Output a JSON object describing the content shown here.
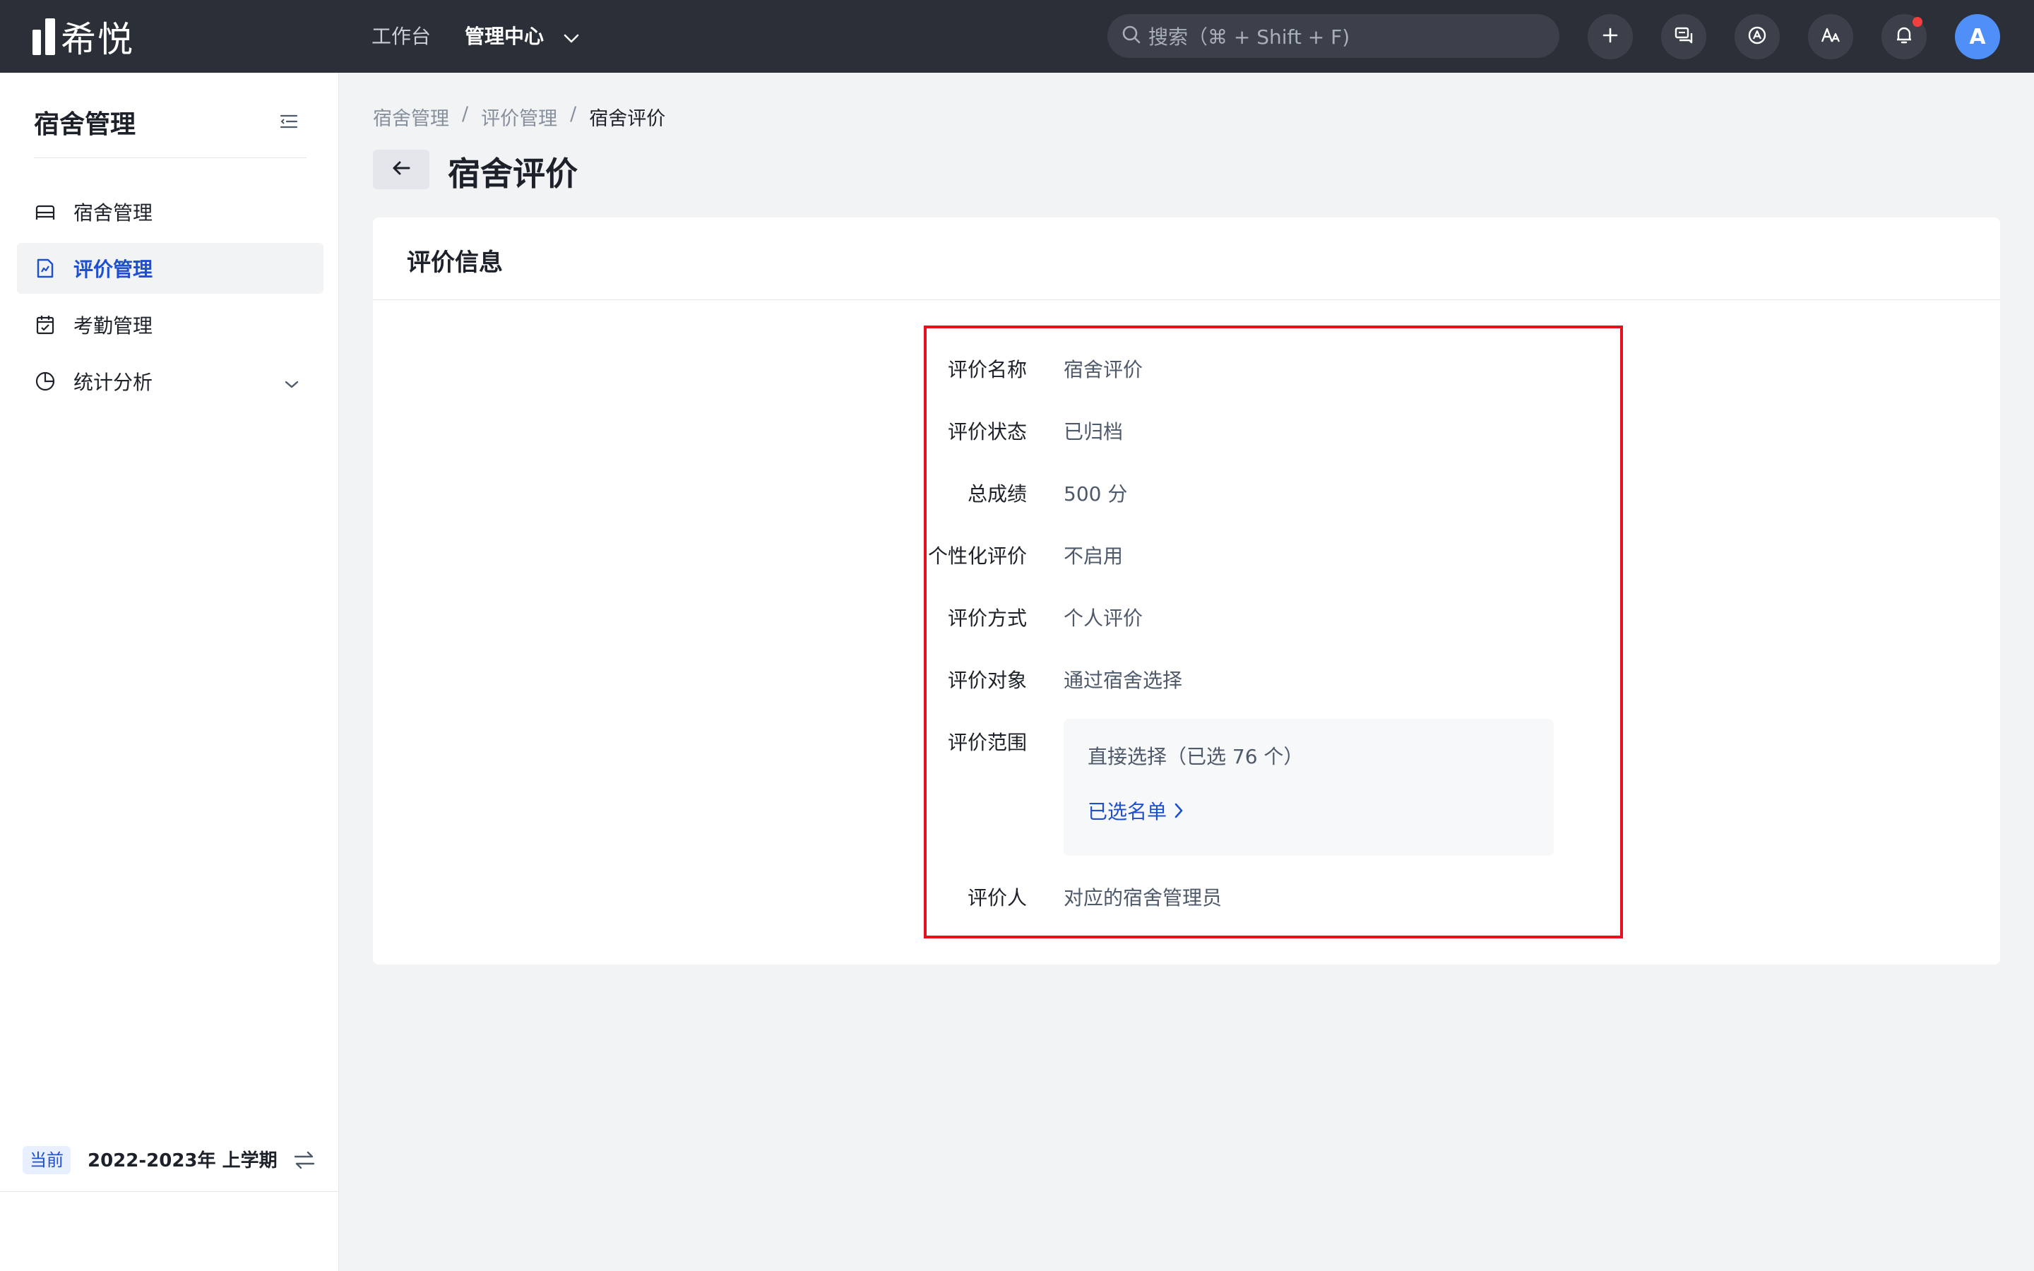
{
  "app": {
    "logo_text": "希悦"
  },
  "topnav": {
    "workbench": "工作台",
    "admin_center": "管理中心",
    "search_placeholder": "搜索（⌘ + Shift + F)",
    "avatar_letter": "A",
    "icons": [
      "plus-icon",
      "message-icon",
      "app-store-icon",
      "translate-icon",
      "bell-icon"
    ],
    "notification_dot_color": "#f53f3f"
  },
  "sidebar": {
    "title": "宿舍管理",
    "items": [
      {
        "label": "宿舍管理",
        "icon": "bed-icon",
        "active": false
      },
      {
        "label": "评价管理",
        "icon": "evaluation-doc-icon",
        "active": true
      },
      {
        "label": "考勤管理",
        "icon": "calendar-check-icon",
        "active": false
      },
      {
        "label": "统计分析",
        "icon": "pie-chart-icon",
        "active": false,
        "expandable": true
      }
    ],
    "term_tag": "当前",
    "term": "2022-2023年 上学期"
  },
  "breadcrumb": [
    "宿舍管理",
    "评价管理",
    "宿舍评价"
  ],
  "breadcrumb_separator": "/",
  "page_title": "宿舍评价",
  "card": {
    "header": "评价信息",
    "fields": [
      {
        "label": "评价名称",
        "value": "宿舍评价"
      },
      {
        "label": "评价状态",
        "value": "已归档"
      },
      {
        "label": "总成绩",
        "value": "500 分"
      },
      {
        "label": "个性化评价",
        "value": "不启用"
      },
      {
        "label": "评价方式",
        "value": "个人评价"
      },
      {
        "label": "评价对象",
        "value": "通过宿舍选择"
      },
      {
        "label": "评价范围",
        "value": ""
      },
      {
        "label": "评价人",
        "value": "对应的宿舍管理员"
      }
    ],
    "scope": {
      "text": "直接选择（已选 76 个）",
      "link": "已选名单"
    }
  },
  "colors": {
    "topbar_bg": "#2b2f38",
    "accent": "#1e4fd0",
    "highlight_border": "#e5111f",
    "avatar_bg": "#4f8ff7"
  }
}
